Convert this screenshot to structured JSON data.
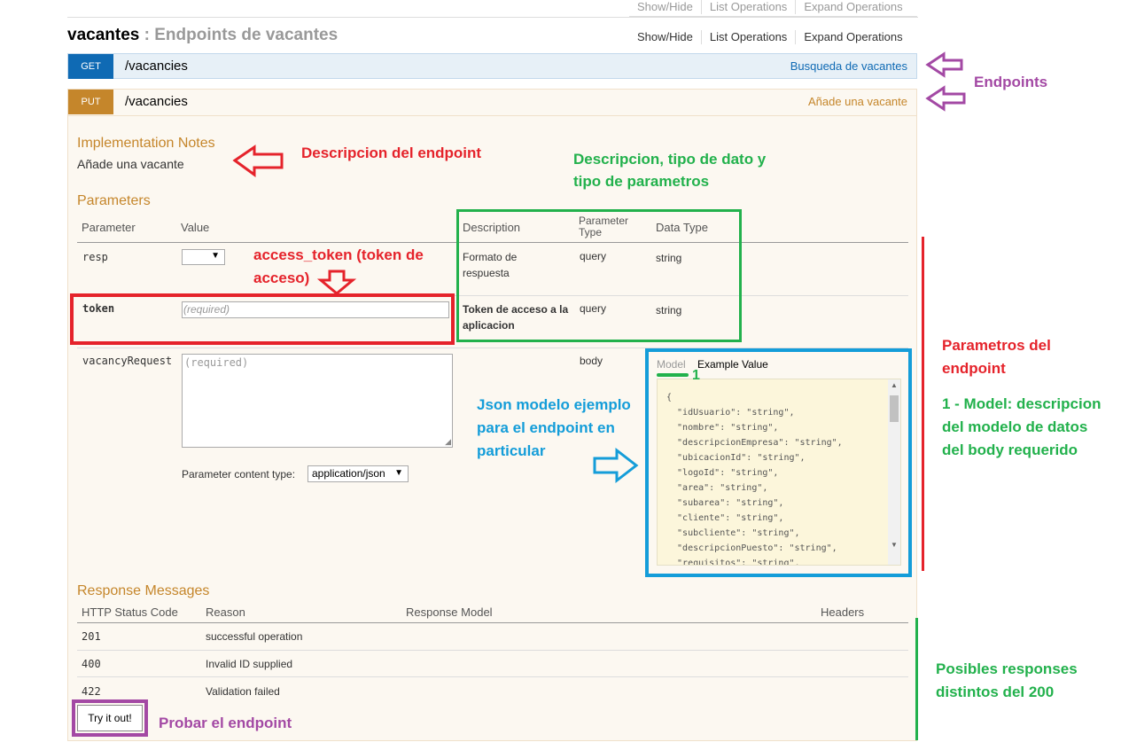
{
  "top_links": [
    "Show/Hide",
    "List Operations",
    "Expand Operations"
  ],
  "resource": {
    "name": "vacantes",
    "separator": " : ",
    "description": "Endpoints de vacantes"
  },
  "op_links": [
    "Show/Hide",
    "List Operations",
    "Expand Operations"
  ],
  "get_op": {
    "method": "GET",
    "path": "/vacancies",
    "summary": "Busqueda de vacantes"
  },
  "put_op": {
    "method": "PUT",
    "path": "/vacancies",
    "summary": "Añade una vacante",
    "impl_title": "Implementation Notes",
    "impl_text": "Añade una vacante",
    "params_title": "Parameters",
    "param_headers": {
      "parameter": "Parameter",
      "value": "Value",
      "description": "Description",
      "param_type_1": "Parameter",
      "param_type_2": "Type",
      "data_type": "Data Type"
    },
    "params": [
      {
        "name": "resp",
        "description": "Formato de respuesta",
        "type": "query",
        "data_type": "string"
      },
      {
        "name": "token",
        "placeholder": "(required)",
        "description": "Token de acceso a la aplicacion",
        "type": "query",
        "data_type": "string"
      },
      {
        "name": "vacancyRequest",
        "placeholder": "(required)",
        "type": "body"
      }
    ],
    "content_type_label": "Parameter content type:",
    "content_type_value": "application/json",
    "model_tabs": [
      "Model",
      "Example Value"
    ],
    "json_lines": [
      "{",
      "  \"idUsuario\": \"string\",",
      "  \"nombre\": \"string\",",
      "  \"descripcionEmpresa\": \"string\",",
      "  \"ubicacionId\": \"string\",",
      "  \"logoId\": \"string\",",
      "  \"area\": \"string\",",
      "  \"subarea\": \"string\",",
      "  \"cliente\": \"string\",",
      "  \"subcliente\": \"string\",",
      "  \"descripcionPuesto\": \"string\",",
      "  \"requisitos\": \"string\","
    ],
    "responses_title": "Response Messages",
    "response_headers": {
      "code": "HTTP Status Code",
      "reason": "Reason",
      "model": "Response Model",
      "headers": "Headers"
    },
    "responses": [
      {
        "code": "201",
        "reason": "successful operation"
      },
      {
        "code": "400",
        "reason": "Invalid ID supplied"
      },
      {
        "code": "422",
        "reason": "Validation failed"
      }
    ],
    "try_button": "Try it out!"
  },
  "annotations": {
    "endpoints": "Endpoints",
    "desc_endpoint": "Descripcion del endpoint",
    "desc_tipo_1": "Descripcion, tipo de dato y",
    "desc_tipo_2": "tipo de parametros",
    "access_token_1": "access_token (token de",
    "access_token_2": "acceso)",
    "params_1": "Parametros del",
    "params_2": "endpoint",
    "model_1": "1 - Model: descripcion",
    "model_2": "del modelo de datos",
    "model_3": "del body requerido",
    "json_1": "Json modelo ejemplo",
    "json_2": "para el endpoint en",
    "json_3": "particular",
    "marker_1": "1",
    "responses_1": "Posibles responses",
    "responses_2": "distintos del 200",
    "probar": "Probar el endpoint"
  },
  "colors": {
    "get": "#0f6ab4",
    "put": "#c5862b",
    "red": "#e5232b",
    "green": "#22b14c",
    "blue": "#149dd9",
    "purple": "#a349a4"
  }
}
